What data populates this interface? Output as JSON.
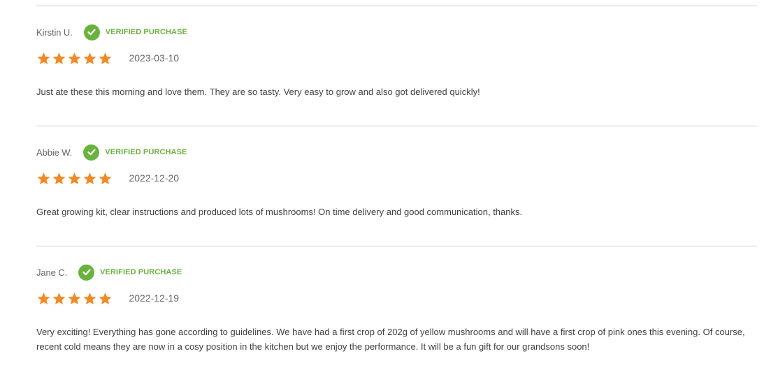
{
  "colors": {
    "accent_green": "#6ab23e",
    "star_orange": "#f08a24"
  },
  "reviews": [
    {
      "name": "Kirstin U.",
      "badge_icon": "check-circle-icon",
      "badge": "VERIFIED PURCHASE",
      "rating": 5,
      "max_rating": 5,
      "date": "2023-03-10",
      "text": "Just ate these this morning and love them. They are so tasty. Very easy to grow and also got delivered quickly!"
    },
    {
      "name": "Abbie W.",
      "badge_icon": "check-circle-icon",
      "badge": "VERIFIED PURCHASE",
      "rating": 5,
      "max_rating": 5,
      "date": "2022-12-20",
      "text": "Great growing kit, clear instructions and produced lots of mushrooms! On time delivery and good communication, thanks."
    },
    {
      "name": "Jane C.",
      "badge_icon": "check-circle-icon",
      "badge": "VERIFIED PURCHASE",
      "rating": 5,
      "max_rating": 5,
      "date": "2022-12-19",
      "text": "Very exciting! Everything has gone according to guidelines. We have had a first crop of 202g of yellow mushrooms and will have a first crop of pink ones this evening. Of course, recent cold means they are now in a cosy position in the kitchen but we enjoy the performance. It will be a fun gift for our grandsons soon!"
    }
  ]
}
